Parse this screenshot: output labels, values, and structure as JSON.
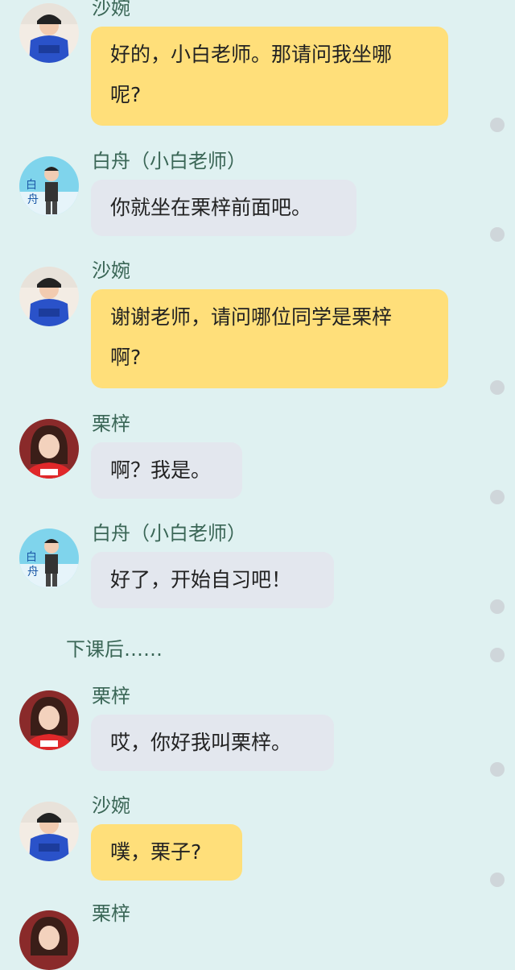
{
  "colors": {
    "background": "#dff1f1",
    "bubble_self": "#ffdf7a",
    "bubble_other": "#e3e7ee",
    "name_text": "#3a6656"
  },
  "messages": [
    {
      "sender": "沙婉",
      "text": "好的，小白老师。那请问我坐哪\n呢?",
      "avatar": "shawan-avatar"
    },
    {
      "sender": "白舟（小白老师）",
      "text": "你就坐在栗梓前面吧。",
      "avatar": "baizhou-avatar"
    },
    {
      "sender": "沙婉",
      "text": "谢谢老师，请问哪位同学是栗梓\n啊?",
      "avatar": "shawan-avatar"
    },
    {
      "sender": "栗梓",
      "text": "啊？我是。",
      "avatar": "lizi-avatar"
    },
    {
      "sender": "白舟（小白老师）",
      "text": "好了，开始自习吧！",
      "avatar": "baizhou-avatar"
    },
    {
      "sender": "栗梓",
      "text": "哎，你好我叫栗梓。",
      "avatar": "lizi-avatar"
    },
    {
      "sender": "沙婉",
      "text": "噗，栗子?",
      "avatar": "shawan-avatar"
    },
    {
      "sender": "栗梓",
      "text": "",
      "avatar": "lizi-avatar"
    }
  ],
  "narration": "下课后……"
}
